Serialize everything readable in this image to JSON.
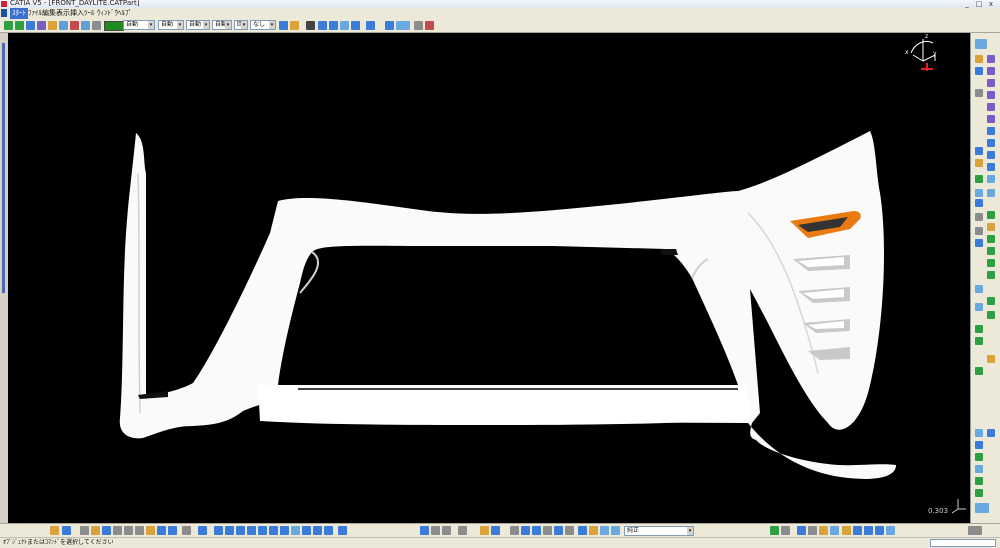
{
  "window": {
    "title": "CATIA V5 - [FRONT_DAYLITE.CATPart]",
    "minimize": "_",
    "maximize": "□",
    "close": "x"
  },
  "menu": {
    "items": [
      "ｽﾀｰﾄ",
      "ﾌｧｲﾙ",
      "編集",
      "表示",
      "挿入",
      "ﾂｰﾙ",
      "ｳｨﾝﾄﾞｳ",
      "ﾍﾙﾌﾟ"
    ]
  },
  "toolbar": {
    "color_value": "#1f8a1f",
    "combo1": "自動",
    "combo2": "自動",
    "combo3": "自動",
    "combo4": "自動",
    "combo5": "回答",
    "combo6": "なし"
  },
  "viewport": {
    "background": "#000000",
    "scale_label": "0.303",
    "compass_axis_x": "x",
    "compass_axis_y": "y",
    "compass_axis_z": "z"
  },
  "bottom_toolbar": {
    "filter_value": "純正"
  },
  "status": {
    "message": "ｵﾌﾞｼﾞｪｸﾄまたはｺﾏﾝﾄﾞを選択してください"
  },
  "part": {
    "body_color": "#ffffff",
    "accent_color": "#e97b12"
  }
}
